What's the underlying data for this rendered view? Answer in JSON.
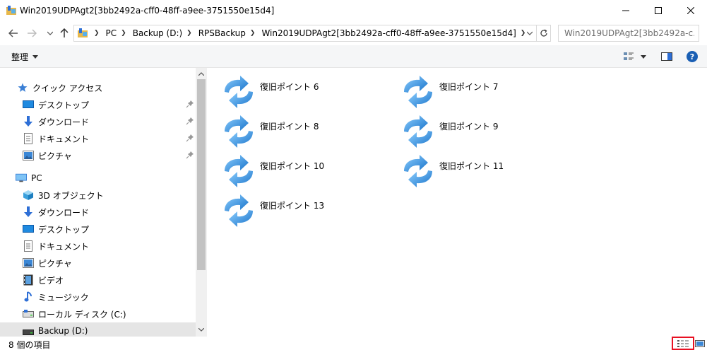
{
  "window": {
    "title": "Win2019UDPAgt2[3bb2492a-cff0-48ff-a9ee-3751550e15d4]",
    "minimize_icon": "minimize-icon",
    "maximize_icon": "maximize-icon",
    "close_icon": "close-icon"
  },
  "address": {
    "crumbs": [
      "PC",
      "Backup (D:)",
      "RPSBackup",
      "Win2019UDPAgt2[3bb2492a-cff0-48ff-a9ee-3751550e15d4]"
    ],
    "search_placeholder": "Win2019UDPAgt2[3bb2492a-c..."
  },
  "toolbar": {
    "organize_label": "整理"
  },
  "nav": {
    "items": [
      {
        "label": "クイック アクセス",
        "icon": "star-icon",
        "pinned": false
      },
      {
        "label": "デスクトップ",
        "icon": "desktop-icon",
        "pinned": true
      },
      {
        "label": "ダウンロード",
        "icon": "download-icon",
        "pinned": true
      },
      {
        "label": "ドキュメント",
        "icon": "document-icon",
        "pinned": true
      },
      {
        "label": "ピクチャ",
        "icon": "picture-icon",
        "pinned": true
      },
      {
        "label": "PC",
        "icon": "pc-icon",
        "pinned": false
      },
      {
        "label": "3D オブジェクト",
        "icon": "3d-objects-icon",
        "pinned": false
      },
      {
        "label": "ダウンロード",
        "icon": "download-icon",
        "pinned": false
      },
      {
        "label": "デスクトップ",
        "icon": "desktop-icon",
        "pinned": false
      },
      {
        "label": "ドキュメント",
        "icon": "document-icon",
        "pinned": false
      },
      {
        "label": "ピクチャ",
        "icon": "picture-icon",
        "pinned": false
      },
      {
        "label": "ビデオ",
        "icon": "video-icon",
        "pinned": false
      },
      {
        "label": "ミュージック",
        "icon": "music-icon",
        "pinned": false
      },
      {
        "label": "ローカル ディスク (C:)",
        "icon": "drive-icon",
        "pinned": false
      },
      {
        "label": "Backup (D:)",
        "icon": "drive-icon",
        "pinned": false
      }
    ]
  },
  "items": [
    {
      "label": "復旧ポイント 6"
    },
    {
      "label": "復旧ポイント 7"
    },
    {
      "label": "復旧ポイント 8"
    },
    {
      "label": "復旧ポイント 9"
    },
    {
      "label": "復旧ポイント 10"
    },
    {
      "label": "復旧ポイント 11"
    },
    {
      "label": "復旧ポイント 13"
    }
  ],
  "status": {
    "count": "8 個の項目"
  },
  "colors": {
    "accent": "#1e90ff",
    "highlight_border": "#e81123",
    "selection": "#cce8ff"
  }
}
